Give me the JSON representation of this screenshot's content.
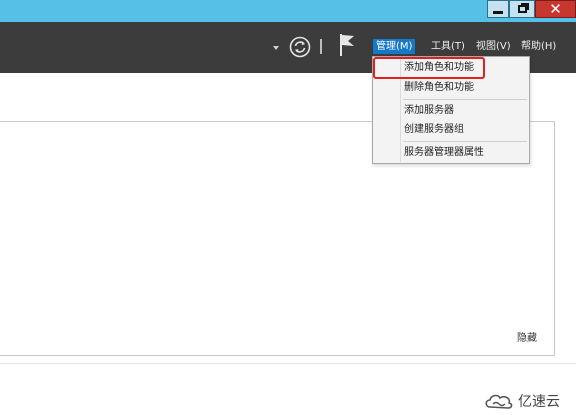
{
  "window": {
    "controls": {
      "close_glyph": "✕"
    }
  },
  "toolbar": {
    "menus": [
      {
        "label": "管理(M)",
        "active": true
      },
      {
        "label": "工具(T)"
      },
      {
        "label": "视图(V)"
      },
      {
        "label": "帮助(H)"
      }
    ],
    "icons": [
      "dropdown-caret-icon",
      "refresh-icon",
      "notification-flag-icon"
    ]
  },
  "dropdown": {
    "items": [
      {
        "label": "添加角色和功能",
        "highlighted": true
      },
      {
        "label": "删除角色和功能"
      },
      {
        "label": "添加服务器"
      },
      {
        "label": "创建服务器组"
      },
      {
        "label": "服务器管理器属性"
      }
    ]
  },
  "content": {
    "hide_label": "隐藏"
  },
  "watermark": {
    "text": "亿速云"
  },
  "colors": {
    "titlebar": "#56c0e6",
    "toolbar": "#3c3c3c",
    "menu_active": "#1579c7",
    "close_button": "#c7362f",
    "highlight": "#e02020"
  }
}
